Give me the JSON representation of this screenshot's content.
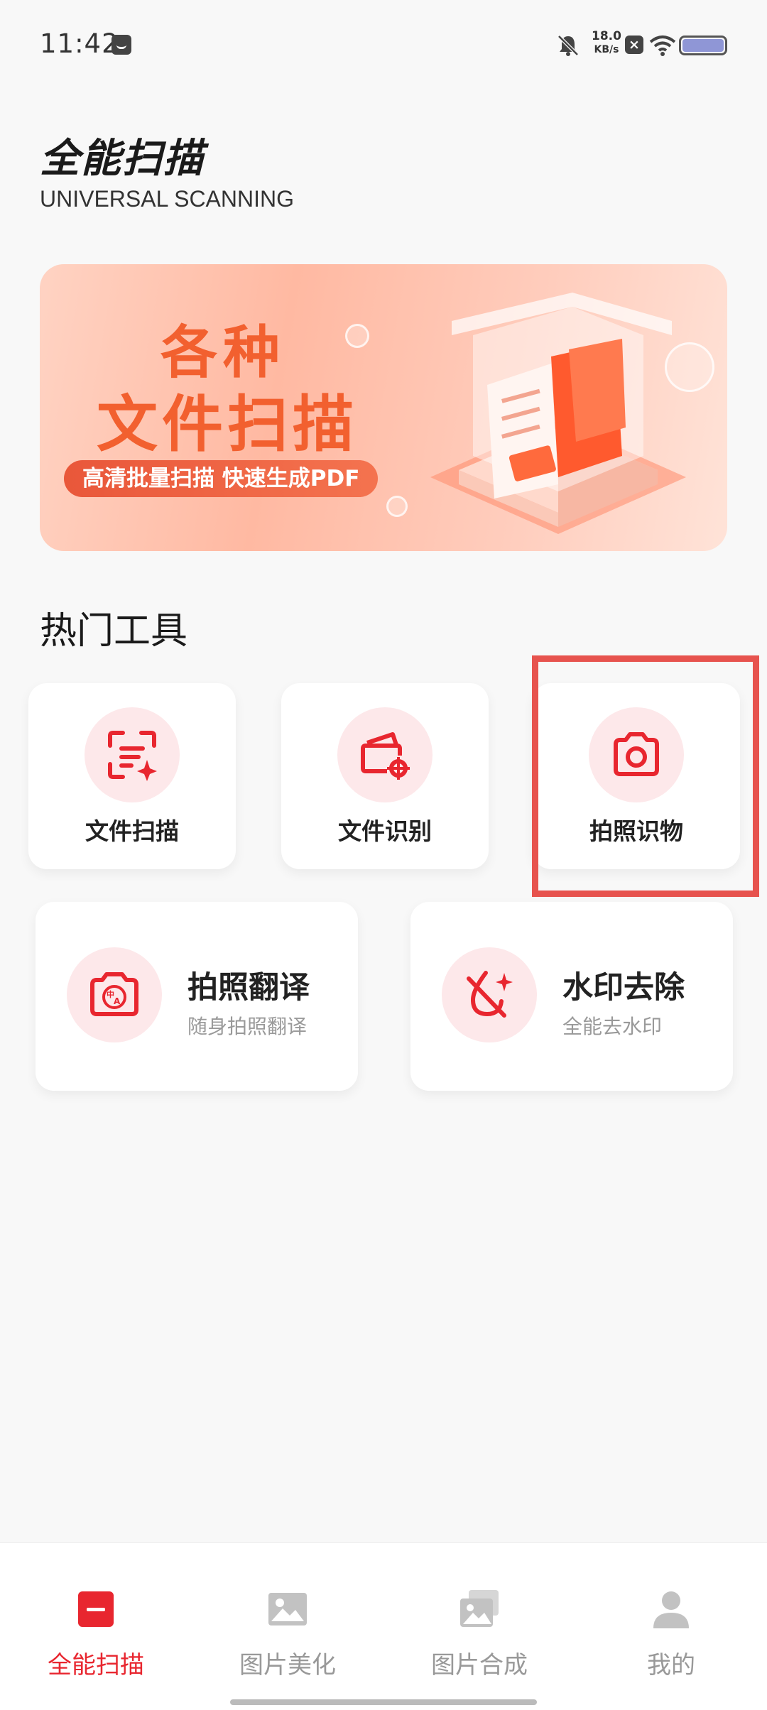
{
  "status_bar": {
    "time": "11:42",
    "net_speed_value": "18.0",
    "net_speed_unit": "KB/s",
    "battery_color": "#8f96d6"
  },
  "header": {
    "title": "全能扫描",
    "subtitle": "UNIVERSAL SCANNING"
  },
  "banner": {
    "line1": "各种",
    "line2": "文件扫描",
    "tagline": "高清批量扫描 快速生成PDF"
  },
  "section": {
    "title": "热门工具"
  },
  "tools_small": [
    {
      "label": "文件扫描",
      "icon": "document-scan-icon"
    },
    {
      "label": "文件识别",
      "icon": "document-recognize-icon"
    },
    {
      "label": "拍照识物",
      "icon": "camera-icon"
    }
  ],
  "tools_wide": [
    {
      "label": "拍照翻译",
      "desc": "随身拍照翻译",
      "icon": "camera-translate-icon"
    },
    {
      "label": "水印去除",
      "desc": "全能去水印",
      "icon": "watermark-remove-icon"
    }
  ],
  "bottom_nav": [
    {
      "label": "全能扫描",
      "icon": "scan-icon",
      "active": true
    },
    {
      "label": "图片美化",
      "icon": "image-icon",
      "active": false
    },
    {
      "label": "图片合成",
      "icon": "image-stack-icon",
      "active": false
    },
    {
      "label": "我的",
      "icon": "user-icon",
      "active": false
    }
  ],
  "colors": {
    "accent": "#e8262f",
    "highlight": "#e7534e",
    "banner_text": "#f2602f"
  }
}
